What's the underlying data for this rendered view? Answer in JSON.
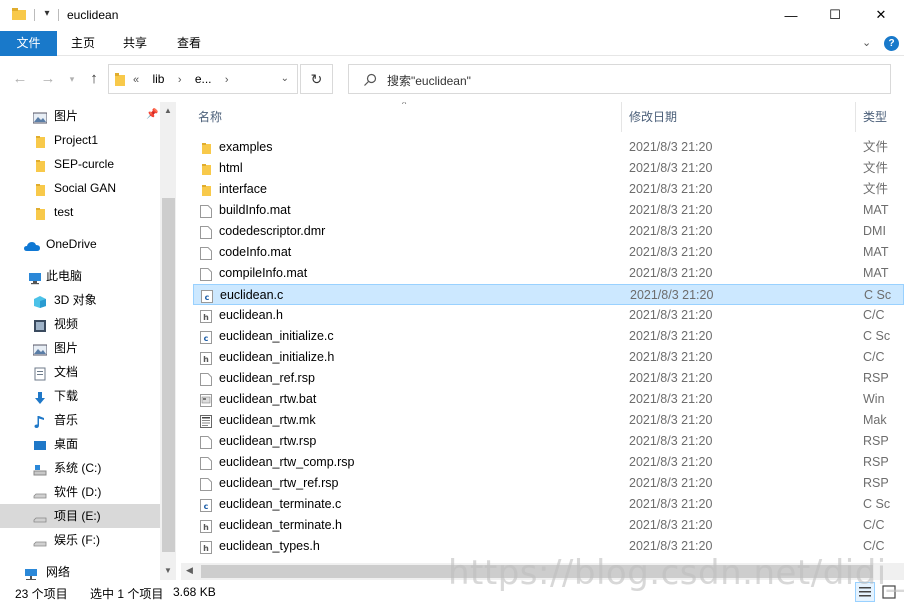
{
  "window": {
    "title": "euclidean",
    "minimize_glyph": "—",
    "maximize_glyph": "☐",
    "close_glyph": "✕"
  },
  "ribbon": {
    "tabs": [
      "文件",
      "主页",
      "共享",
      "查看"
    ],
    "help_glyph": "?"
  },
  "address": {
    "crumbs": [
      "«",
      "lib",
      "›",
      "e...",
      "›"
    ],
    "search_placeholder": "搜索\"euclidean\""
  },
  "nav": {
    "items": [
      {
        "label": "图片",
        "icon": "pictures-icon"
      },
      {
        "label": "Project1",
        "icon": "folder-icon"
      },
      {
        "label": "SEP-curcle",
        "icon": "folder-icon"
      },
      {
        "label": "Social GAN",
        "icon": "folder-icon"
      },
      {
        "label": "test",
        "icon": "folder-icon"
      },
      {
        "label": "OneDrive",
        "icon": "onedrive-icon"
      },
      {
        "label": "此电脑",
        "icon": "this-pc-icon"
      },
      {
        "label": "3D 对象",
        "icon": "3d-objects-icon"
      },
      {
        "label": "视频",
        "icon": "videos-icon"
      },
      {
        "label": "图片",
        "icon": "pictures-icon"
      },
      {
        "label": "文档",
        "icon": "documents-icon"
      },
      {
        "label": "下载",
        "icon": "downloads-icon"
      },
      {
        "label": "音乐",
        "icon": "music-icon"
      },
      {
        "label": "桌面",
        "icon": "desktop-icon"
      },
      {
        "label": "系统 (C:)",
        "icon": "drive-c-icon"
      },
      {
        "label": "软件 (D:)",
        "icon": "drive-icon"
      },
      {
        "label": "项目 (E:)",
        "icon": "drive-icon",
        "selected": true
      },
      {
        "label": "娱乐 (F:)",
        "icon": "drive-icon"
      },
      {
        "label": "网络",
        "icon": "network-icon"
      }
    ]
  },
  "columns": {
    "name": "名称",
    "date": "修改日期",
    "type": "类型"
  },
  "files": [
    {
      "name": "examples",
      "date": "2021/8/3 21:20",
      "type": "文件",
      "kind": "folder"
    },
    {
      "name": "html",
      "date": "2021/8/3 21:20",
      "type": "文件",
      "kind": "folder"
    },
    {
      "name": "interface",
      "date": "2021/8/3 21:20",
      "type": "文件",
      "kind": "folder"
    },
    {
      "name": "buildInfo.mat",
      "date": "2021/8/3 21:20",
      "type": "MAT",
      "kind": "file"
    },
    {
      "name": "codedescriptor.dmr",
      "date": "2021/8/3 21:20",
      "type": "DMI",
      "kind": "file"
    },
    {
      "name": "codeInfo.mat",
      "date": "2021/8/3 21:20",
      "type": "MAT",
      "kind": "file"
    },
    {
      "name": "compileInfo.mat",
      "date": "2021/8/3 21:20",
      "type": "MAT",
      "kind": "file"
    },
    {
      "name": "euclidean.c",
      "date": "2021/8/3 21:20",
      "type": "C Sc",
      "kind": "c",
      "selected": true
    },
    {
      "name": "euclidean.h",
      "date": "2021/8/3 21:20",
      "type": "C/C",
      "kind": "h"
    },
    {
      "name": "euclidean_initialize.c",
      "date": "2021/8/3 21:20",
      "type": "C Sc",
      "kind": "c"
    },
    {
      "name": "euclidean_initialize.h",
      "date": "2021/8/3 21:20",
      "type": "C/C",
      "kind": "h"
    },
    {
      "name": "euclidean_ref.rsp",
      "date": "2021/8/3 21:20",
      "type": "RSP",
      "kind": "file"
    },
    {
      "name": "euclidean_rtw.bat",
      "date": "2021/8/3 21:20",
      "type": "Win",
      "kind": "bat"
    },
    {
      "name": "euclidean_rtw.mk",
      "date": "2021/8/3 21:20",
      "type": "Mak",
      "kind": "mk"
    },
    {
      "name": "euclidean_rtw.rsp",
      "date": "2021/8/3 21:20",
      "type": "RSP",
      "kind": "file"
    },
    {
      "name": "euclidean_rtw_comp.rsp",
      "date": "2021/8/3 21:20",
      "type": "RSP",
      "kind": "file"
    },
    {
      "name": "euclidean_rtw_ref.rsp",
      "date": "2021/8/3 21:20",
      "type": "RSP",
      "kind": "file"
    },
    {
      "name": "euclidean_terminate.c",
      "date": "2021/8/3 21:20",
      "type": "C Sc",
      "kind": "c"
    },
    {
      "name": "euclidean_terminate.h",
      "date": "2021/8/3 21:20",
      "type": "C/C",
      "kind": "h"
    },
    {
      "name": "euclidean_types.h",
      "date": "2021/8/3 21:20",
      "type": "C/C",
      "kind": "h"
    }
  ],
  "status": {
    "count": "23 个项目",
    "selection": "选中 1 个项目",
    "size": "3.68 KB"
  },
  "watermark": "https://blog.csdn.net/didi_ya",
  "colors": {
    "accent": "#1979ca",
    "selection_bg": "#cce8ff",
    "selection_border": "#99d1ff",
    "folder": "#f8c94a"
  }
}
